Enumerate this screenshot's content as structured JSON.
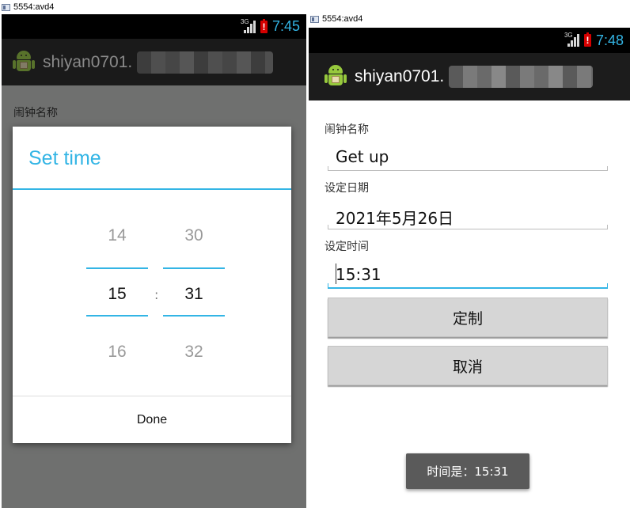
{
  "left_window": {
    "title": "5554:avd4",
    "status": {
      "net": "3G",
      "time": "7:45"
    },
    "app_title": "shiyan0701.",
    "bg_label": "闹钟名称",
    "dialog": {
      "title": "Set time",
      "hours": {
        "prev": "14",
        "current": "15",
        "next": "16"
      },
      "minutes": {
        "prev": "30",
        "current": "31",
        "next": "32"
      },
      "separator": ":",
      "done_label": "Done"
    }
  },
  "right_window": {
    "title": "5554:avd4",
    "status": {
      "net": "3G",
      "time": "7:48"
    },
    "app_title": "shiyan0701.",
    "form": {
      "name_label": "闹钟名称",
      "name_value": "Get up",
      "date_label": "设定日期",
      "date_value": "2021年5月26日",
      "time_label": "设定时间",
      "time_value": "15:31",
      "set_button": "定制",
      "cancel_button": "取消"
    },
    "toast": "时间是：15:31"
  },
  "colors": {
    "accent": "#33b5e5",
    "action_bar": "#1c1c1c",
    "battery": "#d50000"
  }
}
